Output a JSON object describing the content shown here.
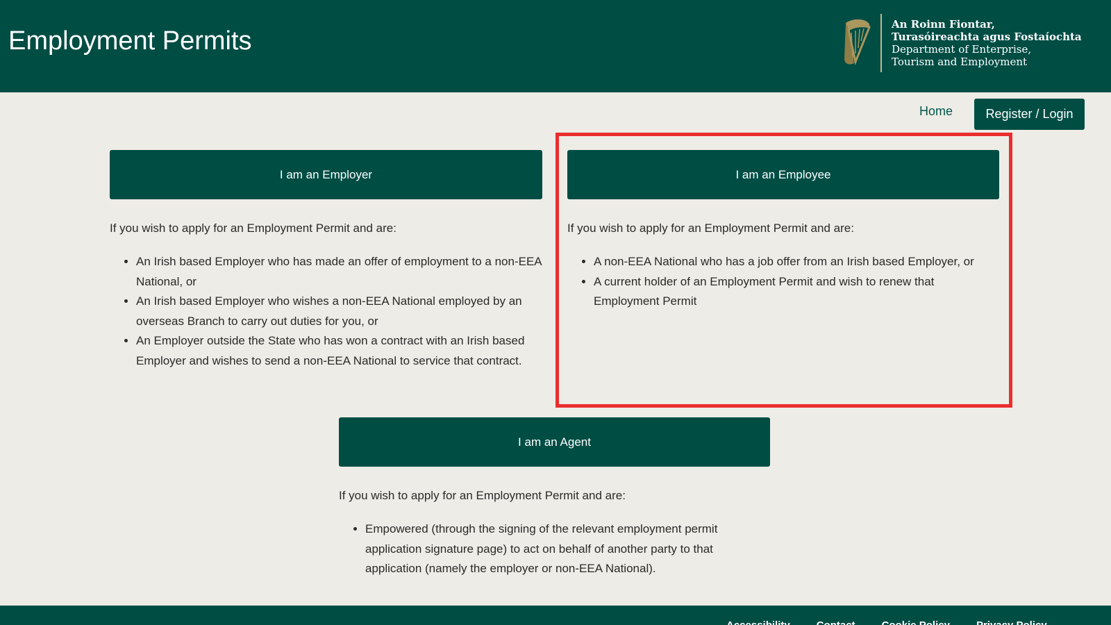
{
  "header": {
    "title": "Employment Permits",
    "logo": {
      "icon": "harp-icon",
      "line1": "An Roinn Fiontar,",
      "line2": "Turasóireachta agus Fostaíochta",
      "line3": "Department of Enterprise,",
      "line4": "Tourism and Employment"
    }
  },
  "nav": {
    "home_label": "Home",
    "register_label": "Register / Login"
  },
  "sections": {
    "employer": {
      "button_label": "I am an Employer",
      "intro": "If you wish to apply for an Employment Permit and are:",
      "bullets": [
        "An Irish based Employer who has made an offer of employment to a non-EEA National, or",
        "An Irish based Employer who wishes a non-EEA National employed by an overseas Branch to carry out duties for you, or",
        "An Employer outside the State who has won a contract with an Irish based Employer and wishes to send a non-EEA National to service that contract."
      ]
    },
    "employee": {
      "button_label": "I am an Employee",
      "intro": "If you wish to apply for an Employment Permit and are:",
      "bullets": [
        "A non-EEA National who has a job offer from an Irish based Employer, or",
        "A current holder of an Employment Permit and wish to renew that Employment Permit"
      ]
    },
    "agent": {
      "button_label": "I am an Agent",
      "intro": "If you wish to apply for an Employment Permit and are:",
      "bullets": [
        "Empowered (through the signing of the relevant employment permit application signature page) to act on behalf of another party to that application (namely the employer or non-EEA National)."
      ]
    }
  },
  "footer": {
    "links": [
      "Accessibility",
      "Contact",
      "Cookie Policy",
      "Privacy Policy"
    ]
  },
  "colors": {
    "brand_green": "#004d44",
    "background": "#eeece6",
    "highlight_red": "#ea2e2e"
  }
}
